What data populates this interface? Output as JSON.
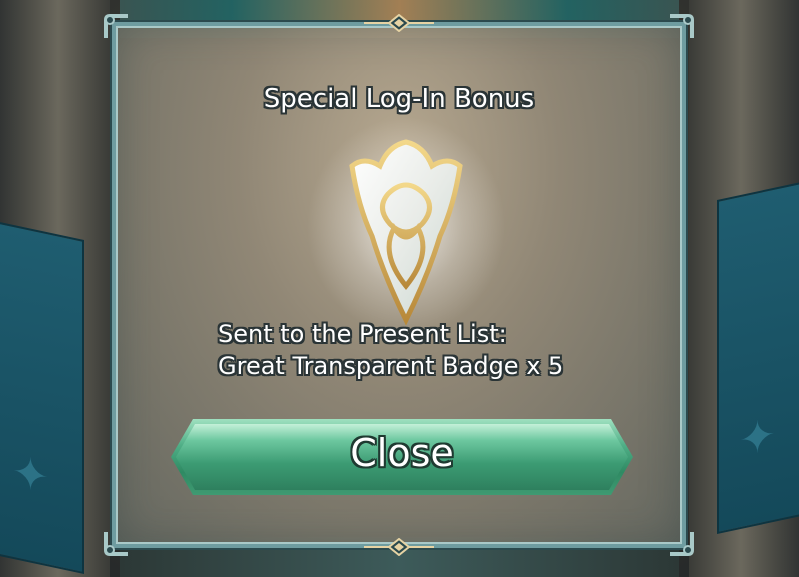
{
  "dialog": {
    "title": "Special Log-In Bonus",
    "message_line1": "Sent to the Present List:",
    "message_line2": "Great Transparent Badge x 5",
    "close_label": "Close",
    "item_icon": "great-transparent-badge-icon"
  },
  "colors": {
    "frame": "#6e9ca0",
    "button_green": "#3c9b73",
    "badge_gold": "#d8b25a",
    "banner_teal": "#1f5d70"
  }
}
